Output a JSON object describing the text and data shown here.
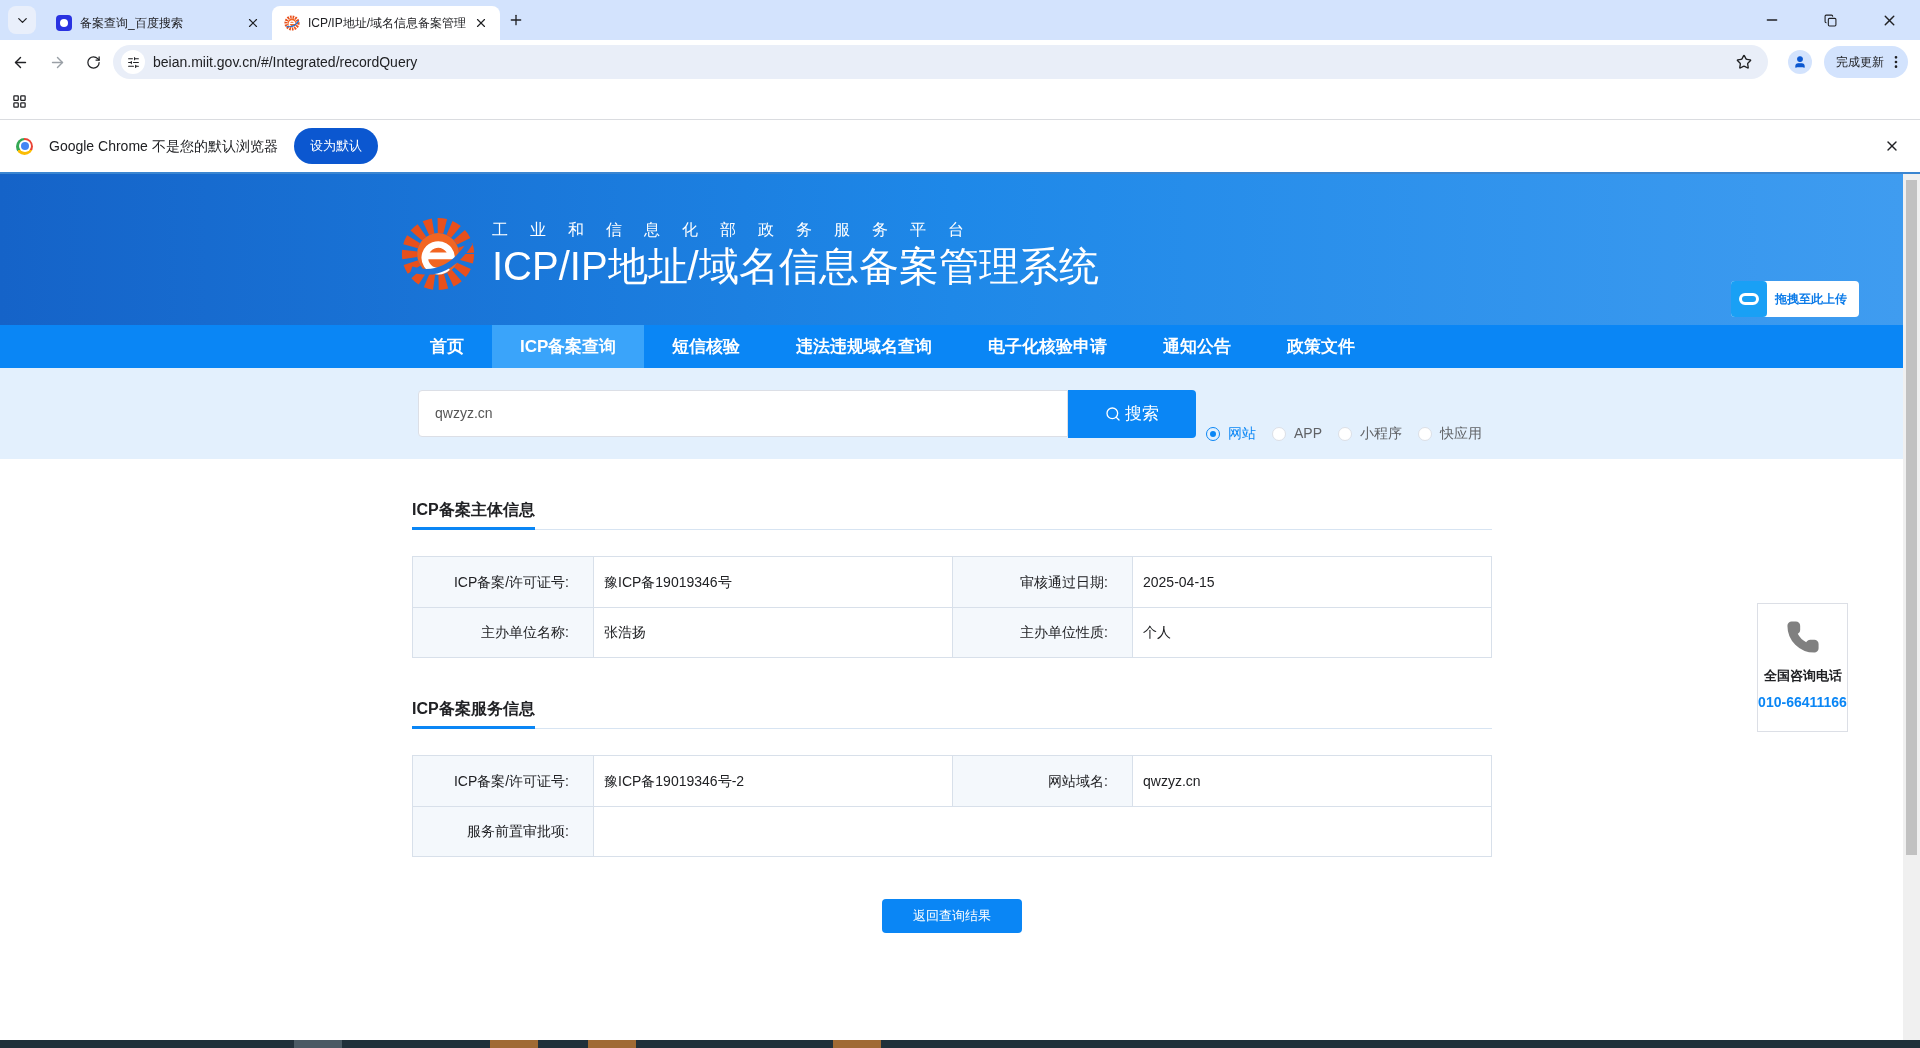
{
  "browser": {
    "tabs": [
      {
        "title": "备案查询_百度搜索",
        "selected": false,
        "kind": "baidu"
      },
      {
        "title": "ICP/IP地址/域名信息备案管理",
        "selected": true,
        "kind": "logo"
      }
    ],
    "address": "beian.miit.gov.cn/#/Integrated/recordQuery",
    "update_button": "完成更新"
  },
  "infobar": {
    "message": "Google Chrome 不是您的默认浏览器",
    "button": "设为默认"
  },
  "header": {
    "subtitle": "工业和信息化部政务服务平台",
    "title": "ICP/IP地址/域名信息备案管理系统",
    "upload_button": "拖拽至此上传"
  },
  "nav": [
    {
      "label": "首页",
      "selected": false
    },
    {
      "label": "ICP备案查询",
      "selected": true
    },
    {
      "label": "短信核验",
      "selected": false
    },
    {
      "label": "违法违规域名查询",
      "selected": false
    },
    {
      "label": "电子化核验申请",
      "selected": false
    },
    {
      "label": "通知公告",
      "selected": false
    },
    {
      "label": "政策文件",
      "selected": false
    }
  ],
  "search": {
    "value": "qwzyz.cn",
    "button": "搜索",
    "types": [
      {
        "label": "网站",
        "selected": true
      },
      {
        "label": "APP",
        "selected": false
      },
      {
        "label": "小程序",
        "selected": false
      },
      {
        "label": "快应用",
        "selected": false
      }
    ]
  },
  "sections": [
    {
      "title": "ICP备案主体信息",
      "rows": [
        [
          {
            "label": "ICP备案/许可证号:",
            "value": "豫ICP备19019346号"
          },
          {
            "label": "审核通过日期:",
            "value": "2025-04-15"
          }
        ],
        [
          {
            "label": "主办单位名称:",
            "value": "张浩扬"
          },
          {
            "label": "主办单位性质:",
            "value": "个人"
          }
        ]
      ]
    },
    {
      "title": "ICP备案服务信息",
      "rows": [
        [
          {
            "label": "ICP备案/许可证号:",
            "value": "豫ICP备19019346号-2"
          },
          {
            "label": "网站域名:",
            "value": "qwzyz.cn"
          }
        ],
        [
          {
            "label": "服务前置审批项:"
          }
        ]
      ]
    }
  ],
  "back_button": "返回查询结果",
  "hotline": {
    "title": "全国咨询电话",
    "number": "010-66411166"
  }
}
